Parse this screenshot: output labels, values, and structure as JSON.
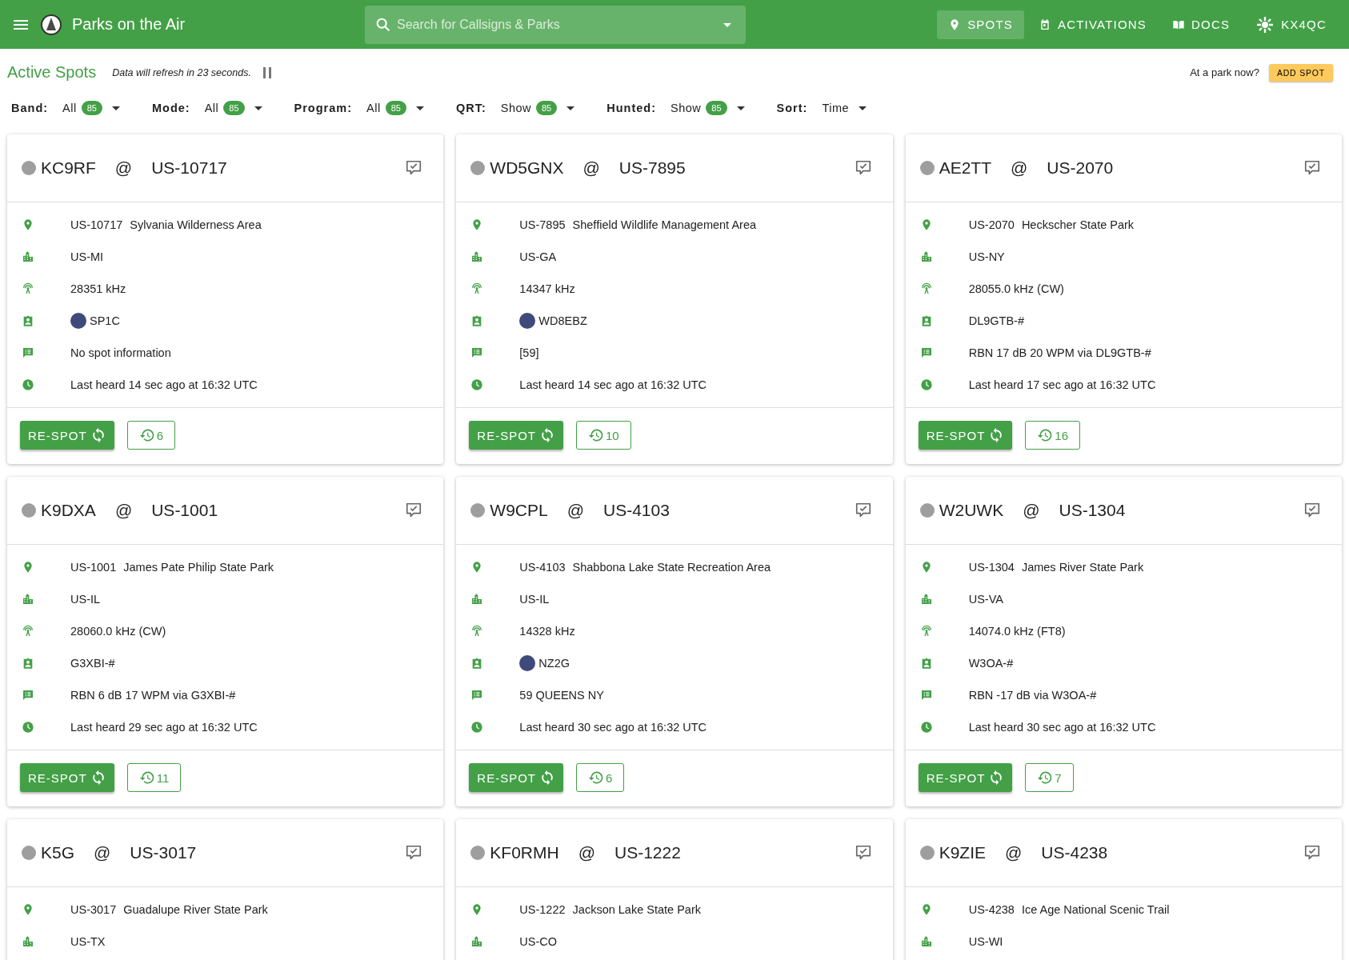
{
  "app_bar": {
    "title": "Parks on the Air",
    "search": {
      "placeholder": "Search for Callsigns & Parks"
    },
    "nav": [
      {
        "label": "SPOTS",
        "kind": "spots",
        "selected": true
      },
      {
        "label": "ACTIVATIONS",
        "kind": "activations",
        "selected": false
      },
      {
        "label": "DOCS",
        "kind": "docs",
        "selected": false
      },
      {
        "label": "KX4QC",
        "kind": "user",
        "selected": false
      }
    ]
  },
  "page_title": "Active Spots",
  "refresh_note": "Data will refresh in 23 seconds.",
  "park_prompt": "At a park now?",
  "add_spot": "ADD SPOT",
  "filters": [
    {
      "label": "Band:",
      "value": "All",
      "count": "85"
    },
    {
      "label": "Mode:",
      "value": "All",
      "count": "85"
    },
    {
      "label": "Program:",
      "value": "All",
      "count": "85"
    },
    {
      "label": "QRT:",
      "value": "Show",
      "count": "85"
    },
    {
      "label": "Hunted:",
      "value": "Show",
      "count": "85"
    },
    {
      "label": "Sort:",
      "value": "Time"
    }
  ],
  "spots": [
    {
      "activator": "KC9RF",
      "at": "@",
      "park": "US-10717",
      "rows": [
        {
          "kind": "park",
          "ref": "US-10717",
          "text": "Sylvania Wilderness Area"
        },
        {
          "kind": "location",
          "text": "US-MI"
        },
        {
          "kind": "frequency",
          "text": "28351 kHz"
        },
        {
          "kind": "spotter",
          "text": "SP1C",
          "avatar": true
        },
        {
          "kind": "comment",
          "text": "No spot information"
        },
        {
          "kind": "time",
          "text": "Last heard 14 sec ago at 16:32 UTC"
        }
      ],
      "respot": "RE-SPOT",
      "history": "6"
    },
    {
      "activator": "WD5GNX",
      "at": "@",
      "park": "US-7895",
      "rows": [
        {
          "kind": "park",
          "ref": "US-7895",
          "text": "Sheffield Wildlife Management Area"
        },
        {
          "kind": "location",
          "text": "US-GA"
        },
        {
          "kind": "frequency",
          "text": "14347 kHz"
        },
        {
          "kind": "spotter",
          "text": "WD8EBZ",
          "avatar": true
        },
        {
          "kind": "comment",
          "text": "[59]"
        },
        {
          "kind": "time",
          "text": "Last heard 14 sec ago at 16:32 UTC"
        }
      ],
      "respot": "RE-SPOT",
      "history": "10"
    },
    {
      "activator": "AE2TT",
      "at": "@",
      "park": "US-2070",
      "rows": [
        {
          "kind": "park",
          "ref": "US-2070",
          "text": "Heckscher State Park"
        },
        {
          "kind": "location",
          "text": "US-NY"
        },
        {
          "kind": "frequency",
          "text": "28055.0 kHz (CW)"
        },
        {
          "kind": "spotter",
          "text": "DL9GTB-#",
          "avatar": false
        },
        {
          "kind": "comment",
          "text": "RBN 17 dB 20 WPM via DL9GTB-#"
        },
        {
          "kind": "time",
          "text": "Last heard 17 sec ago at 16:32 UTC"
        }
      ],
      "respot": "RE-SPOT",
      "history": "16"
    },
    {
      "activator": "K9DXA",
      "at": "@",
      "park": "US-1001",
      "rows": [
        {
          "kind": "park",
          "ref": "US-1001",
          "text": "James Pate Philip State Park"
        },
        {
          "kind": "location",
          "text": "US-IL"
        },
        {
          "kind": "frequency",
          "text": "28060.0 kHz (CW)"
        },
        {
          "kind": "spotter",
          "text": "G3XBI-#",
          "avatar": false
        },
        {
          "kind": "comment",
          "text": "RBN 6 dB 17 WPM via G3XBI-#"
        },
        {
          "kind": "time",
          "text": "Last heard 29 sec ago at 16:32 UTC"
        }
      ],
      "respot": "RE-SPOT",
      "history": "11"
    },
    {
      "activator": "W9CPL",
      "at": "@",
      "park": "US-4103",
      "rows": [
        {
          "kind": "park",
          "ref": "US-4103",
          "text": "Shabbona Lake State Recreation Area"
        },
        {
          "kind": "location",
          "text": "US-IL"
        },
        {
          "kind": "frequency",
          "text": "14328 kHz"
        },
        {
          "kind": "spotter",
          "text": "NZ2G",
          "avatar": true
        },
        {
          "kind": "comment",
          "text": "59 QUEENS NY"
        },
        {
          "kind": "time",
          "text": "Last heard 30 sec ago at 16:32 UTC"
        }
      ],
      "respot": "RE-SPOT",
      "history": "6"
    },
    {
      "activator": "W2UWK",
      "at": "@",
      "park": "US-1304",
      "rows": [
        {
          "kind": "park",
          "ref": "US-1304",
          "text": "James River State Park"
        },
        {
          "kind": "location",
          "text": "US-VA"
        },
        {
          "kind": "frequency",
          "text": "14074.0 kHz (FT8)"
        },
        {
          "kind": "spotter",
          "text": "W3OA-#",
          "avatar": false
        },
        {
          "kind": "comment",
          "text": "RBN -17 dB via W3OA-#"
        },
        {
          "kind": "time",
          "text": "Last heard 30 sec ago at 16:32 UTC"
        }
      ],
      "respot": "RE-SPOT",
      "history": "7"
    },
    {
      "activator": "K5G",
      "at": "@",
      "park": "US-3017",
      "rows": [
        {
          "kind": "park",
          "ref": "US-3017",
          "text": "Guadalupe River State Park"
        },
        {
          "kind": "location",
          "text": "US-TX"
        }
      ]
    },
    {
      "activator": "KF0RMH",
      "at": "@",
      "park": "US-1222",
      "rows": [
        {
          "kind": "park",
          "ref": "US-1222",
          "text": "Jackson Lake State Park"
        },
        {
          "kind": "location",
          "text": "US-CO"
        }
      ]
    },
    {
      "activator": "K9ZIE",
      "at": "@",
      "park": "US-4238",
      "rows": [
        {
          "kind": "park",
          "ref": "US-4238",
          "text": "Ice Age National Scenic Trail"
        },
        {
          "kind": "location",
          "text": "US-WI"
        }
      ]
    }
  ]
}
